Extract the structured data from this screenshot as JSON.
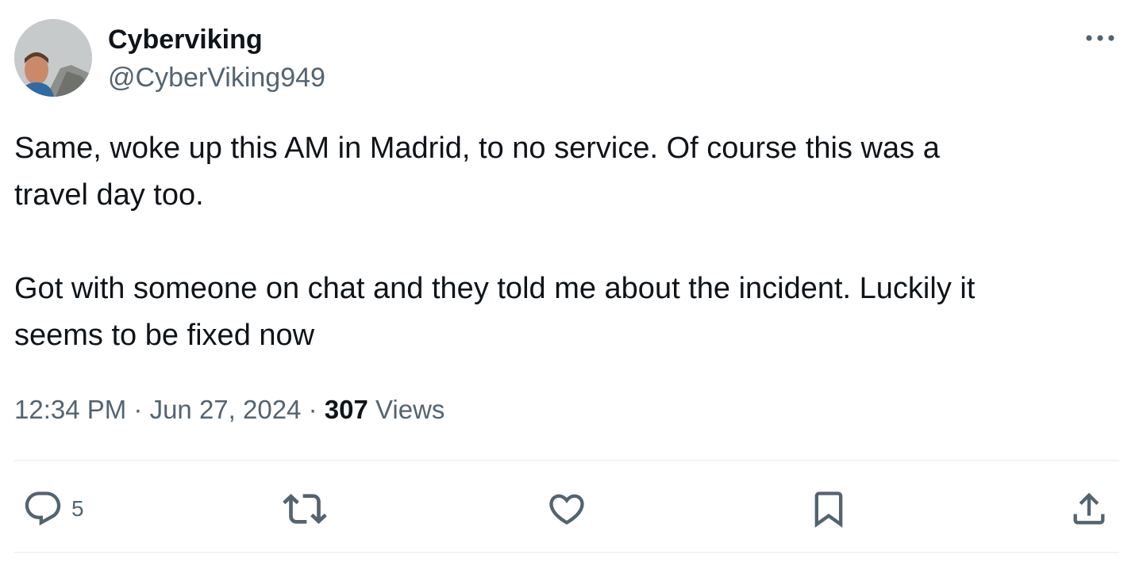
{
  "author": {
    "display_name": "Cyberviking",
    "handle": "@CyberViking949",
    "avatar_icon": "profile-photo"
  },
  "tweet": {
    "paragraph_1_line_1": "Same, woke up this AM in Madrid, to no service. Of course this was a",
    "paragraph_1_line_2": "travel day too.",
    "paragraph_2_line_1": "Got with someone on chat and they told me about the incident. Luckily it",
    "paragraph_2_line_2": "seems to be fixed now"
  },
  "meta": {
    "time": "12:34 PM",
    "separator_1": " · ",
    "date": "Jun 27, 2024",
    "separator_2": " · ",
    "views_count": "307",
    "views_label": " Views"
  },
  "actions": {
    "reply_count": "5",
    "reply_icon": "speech-bubble",
    "retweet_icon": "repost-arrows",
    "like_icon": "heart",
    "bookmark_icon": "bookmark",
    "share_icon": "upload-arrow"
  },
  "colors": {
    "text_primary": "#0f1419",
    "text_secondary": "#536471",
    "divider": "#eff3f4"
  }
}
